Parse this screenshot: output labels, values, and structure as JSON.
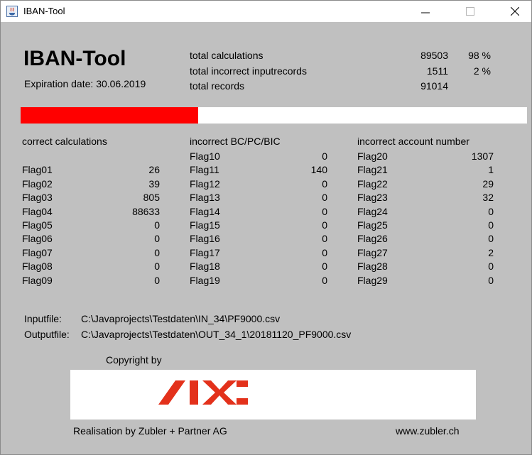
{
  "window": {
    "title": "IBAN-Tool",
    "icons": {
      "app": "java-app-icon",
      "minimize": "minimize-icon",
      "maximize": "maximize-icon",
      "close": "close-icon"
    }
  },
  "header": {
    "app_name": "IBAN-Tool",
    "expiration_label": "Expiration date:",
    "expiration_date": "30.06.2019"
  },
  "totals": [
    {
      "label": "total calculations",
      "value": "89503",
      "percent": "98 %"
    },
    {
      "label": "total incorrect inputrecords",
      "value": "1511",
      "percent": "2 %"
    },
    {
      "label": "total records",
      "value": "91014",
      "percent": ""
    }
  ],
  "progress": {
    "fraction": 0.35,
    "fill_color": "#ff0000",
    "track_color": "#ffffff"
  },
  "groups": {
    "correct": {
      "heading": "correct calculations",
      "rows": [
        {
          "flag": "Flag01",
          "value": "26"
        },
        {
          "flag": "Flag02",
          "value": "39"
        },
        {
          "flag": "Flag03",
          "value": "805"
        },
        {
          "flag": "Flag04",
          "value": "88633"
        },
        {
          "flag": "Flag05",
          "value": "0"
        },
        {
          "flag": "Flag06",
          "value": "0"
        },
        {
          "flag": "Flag07",
          "value": "0"
        },
        {
          "flag": "Flag08",
          "value": "0"
        },
        {
          "flag": "Flag09",
          "value": "0"
        }
      ]
    },
    "bc": {
      "heading": "incorrect BC/PC/BIC",
      "rows": [
        {
          "flag": "Flag10",
          "value": "0"
        },
        {
          "flag": "Flag11",
          "value": "140"
        },
        {
          "flag": "Flag12",
          "value": "0"
        },
        {
          "flag": "Flag13",
          "value": "0"
        },
        {
          "flag": "Flag14",
          "value": "0"
        },
        {
          "flag": "Flag15",
          "value": "0"
        },
        {
          "flag": "Flag16",
          "value": "0"
        },
        {
          "flag": "Flag17",
          "value": "0"
        },
        {
          "flag": "Flag18",
          "value": "0"
        },
        {
          "flag": "Flag19",
          "value": "0"
        }
      ]
    },
    "account": {
      "heading": "incorrect account number",
      "rows": [
        {
          "flag": "Flag20",
          "value": "1307"
        },
        {
          "flag": "Flag21",
          "value": "1"
        },
        {
          "flag": "Flag22",
          "value": "29"
        },
        {
          "flag": "Flag23",
          "value": "32"
        },
        {
          "flag": "Flag24",
          "value": "0"
        },
        {
          "flag": "Flag25",
          "value": "0"
        },
        {
          "flag": "Flag26",
          "value": "0"
        },
        {
          "flag": "Flag27",
          "value": "2"
        },
        {
          "flag": "Flag28",
          "value": "0"
        },
        {
          "flag": "Flag29",
          "value": "0"
        }
      ]
    }
  },
  "files": {
    "input_label": "Inputfile:",
    "input_path": "C:\\Javaprojects\\Testdaten\\IN_34\\PF9000.csv",
    "output_label": "Outputfile:",
    "output_path": "C:\\Javaprojects\\Testdaten\\OUT_34_1\\20181120_PF9000.csv"
  },
  "footer": {
    "copyright": "Copyright by",
    "logo_text": "SIX",
    "logo_color": "#e3311b",
    "realisation": "Realisation by Zubler + Partner AG",
    "website": "www.zubler.ch"
  }
}
